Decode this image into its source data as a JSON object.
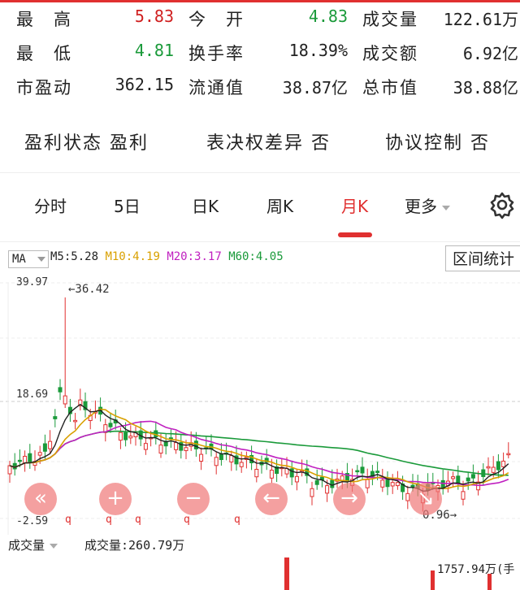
{
  "stats": {
    "row1": [
      {
        "label": "最　高",
        "value": "5.83",
        "color": "#d02020"
      },
      {
        "label": "今　开",
        "value": "4.83",
        "color": "#1a9a3a"
      },
      {
        "label": "成交量",
        "value": "122.61万",
        "color": "#222"
      }
    ],
    "row2": [
      {
        "label": "最　低",
        "value": "4.81",
        "color": "#1a9a3a"
      },
      {
        "label": "换手率",
        "value": "18.39%",
        "color": "#222"
      },
      {
        "label": "成交额",
        "value": "6.92亿",
        "color": "#222"
      }
    ],
    "row3": [
      {
        "label": "市盈动",
        "value": "362.15",
        "color": "#222"
      },
      {
        "label": "流通值",
        "value": "38.87亿",
        "color": "#222"
      },
      {
        "label": "总市值",
        "value": "38.88亿",
        "color": "#222"
      }
    ]
  },
  "tags": [
    {
      "label": "盈利状态",
      "value": "盈利"
    },
    {
      "label": "表决权差异",
      "value": "否"
    },
    {
      "label": "协议控制",
      "value": "否"
    }
  ],
  "tabs": [
    "分时",
    "5日",
    "日K",
    "周K",
    "月K",
    "更多"
  ],
  "active_tab": "月K",
  "settings_icon": "gear-icon",
  "chart": {
    "ma_selector": "MA",
    "ma": [
      {
        "label": "M5:5.28",
        "color": "#222"
      },
      {
        "label": "M10:4.19",
        "color": "#d9a000"
      },
      {
        "label": "M20:3.17",
        "color": "#c020c0"
      },
      {
        "label": "M60:4.05",
        "color": "#1a9a3a"
      }
    ],
    "range_button": "区间统计",
    "y_top": "39.97",
    "y_mid": "18.69",
    "y_bottom": "-2.59",
    "max_marker": "←36.42",
    "min_marker": "0.96→",
    "controls": [
      "«",
      "+",
      "−",
      "←",
      "→",
      "↘"
    ],
    "markers": [
      "q",
      "q",
      "q",
      "q",
      "q"
    ],
    "colors": {
      "up": "#e03030",
      "down": "#1a9a3a"
    }
  },
  "volume": {
    "selector": "成交量",
    "current": "成交量:260.79万",
    "max_label": "1757.94万(手"
  }
}
